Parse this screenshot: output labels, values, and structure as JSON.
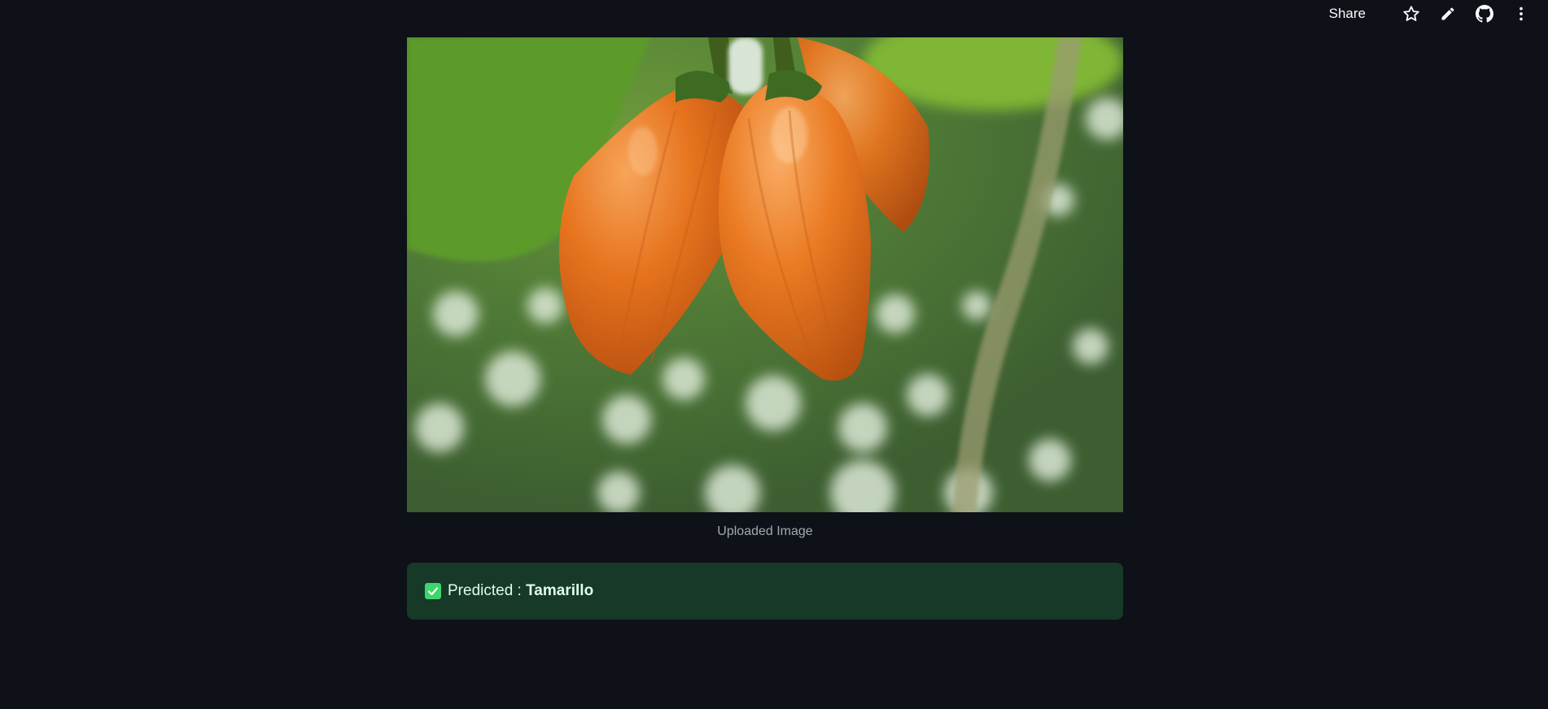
{
  "toolbar": {
    "share_label": "Share",
    "icons": [
      "star-icon",
      "pencil-icon",
      "github-icon",
      "more-vertical-icon"
    ]
  },
  "image": {
    "alt": "Uploaded Image",
    "caption": "Uploaded Image"
  },
  "result": {
    "icon": "check-box-icon",
    "prefix": "Predicted : ",
    "value": "Tamarillo"
  },
  "colors": {
    "background": "#0e1117",
    "alert_bg": "#173928",
    "alert_text": "#dffde9",
    "check": "#3dd56d"
  }
}
